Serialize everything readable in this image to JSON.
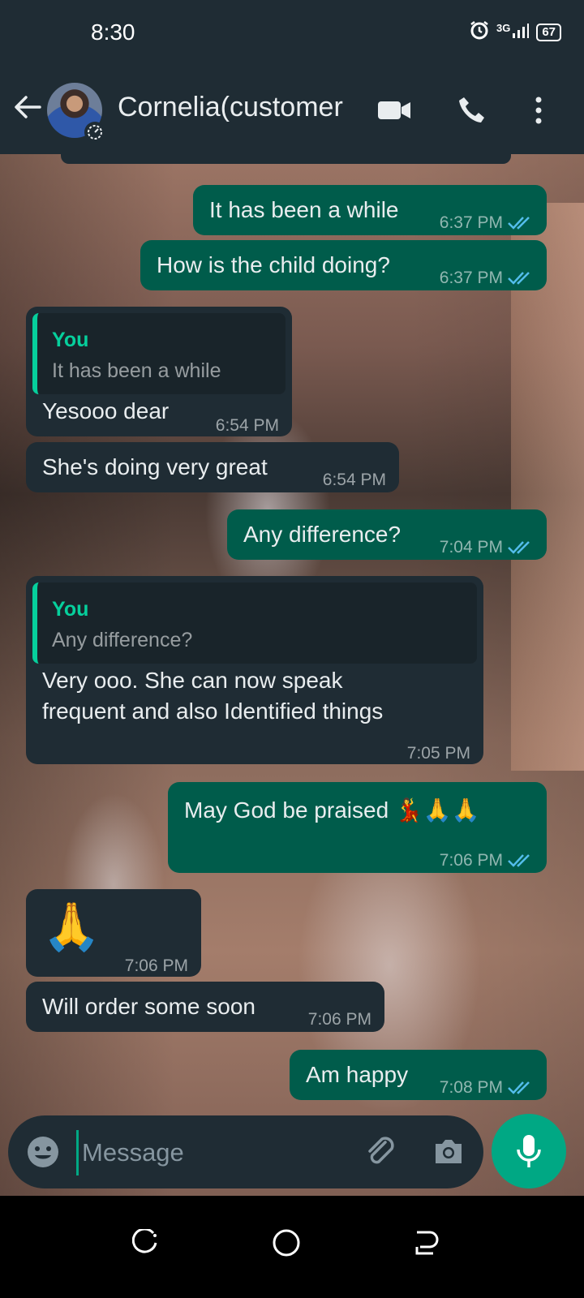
{
  "status_bar": {
    "time": "8:30",
    "network": "3G",
    "battery": "67"
  },
  "header": {
    "contact_name": "Cornelia(customer"
  },
  "messages": [
    {
      "dir": "out",
      "text": "It has been a while",
      "time": "6:37 PM"
    },
    {
      "dir": "out",
      "text": "How is the child doing?",
      "time": "6:37 PM"
    },
    {
      "dir": "in",
      "quote_name": "You",
      "quote_text": "It has been a while",
      "text": "Yesooo  dear",
      "time": "6:54 PM"
    },
    {
      "dir": "in",
      "text": "She's  doing very great",
      "time": "6:54 PM"
    },
    {
      "dir": "out",
      "text": "Any difference?",
      "time": "7:04 PM"
    },
    {
      "dir": "in",
      "quote_name": "You",
      "quote_text": "Any difference?",
      "text_line1": "Very ooo. She can now speak",
      "text_line2": "frequent  and also Identified  things",
      "time": "7:05 PM"
    },
    {
      "dir": "out",
      "text": "May God be praised",
      "emojis": "💃🙏🙏",
      "time": "7:06 PM"
    },
    {
      "dir": "in",
      "emoji": "🙏",
      "time": "7:06 PM"
    },
    {
      "dir": "in",
      "text": "Will order some soon",
      "time": "7:06 PM"
    },
    {
      "dir": "out",
      "text": "Am happy",
      "time": "7:08 PM"
    }
  ],
  "input": {
    "placeholder": "Message"
  },
  "colors": {
    "outgoing": "#005c4b",
    "incoming": "#1f2c34",
    "accent": "#00a884",
    "read_tick": "#53bdeb"
  },
  "icons": [
    "back-arrow-icon",
    "video-call-icon",
    "voice-call-icon",
    "more-options-icon",
    "emoji-icon",
    "attach-icon",
    "camera-icon",
    "mic-icon",
    "alarm-icon",
    "signal-icon"
  ]
}
